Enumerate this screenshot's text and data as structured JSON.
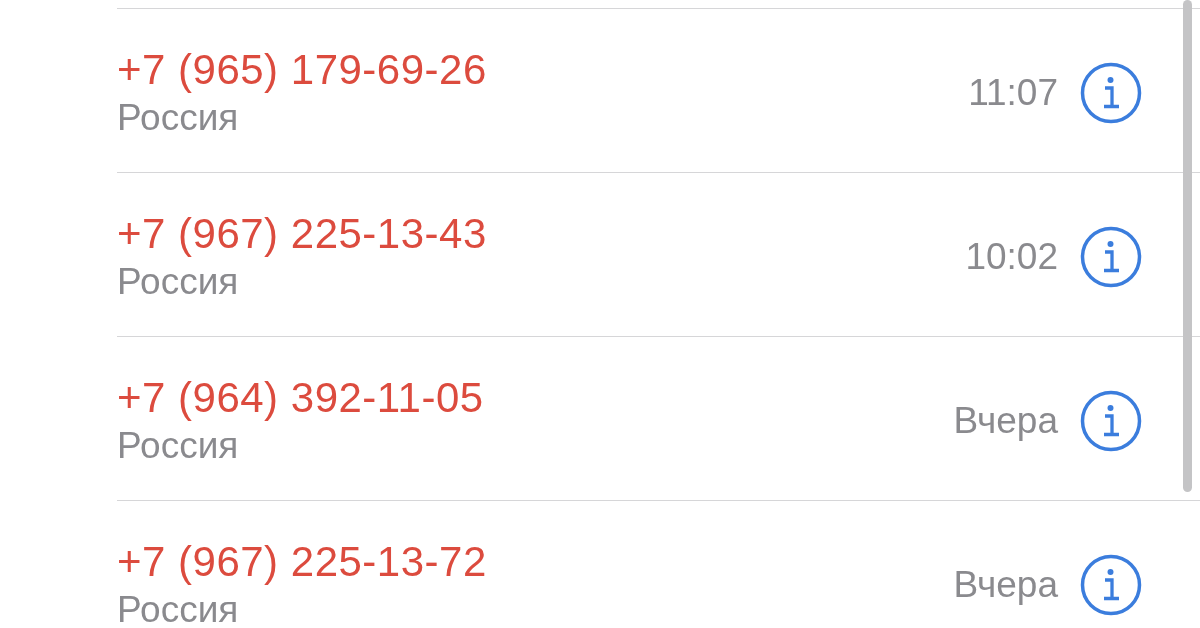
{
  "calls": [
    {
      "number": "+7 (965) 179-69-26",
      "country": "Россия",
      "time": "11:07",
      "missed": true
    },
    {
      "number": "+7 (967) 225-13-43",
      "country": "Россия",
      "time": "10:02",
      "missed": true
    },
    {
      "number": "+7 (964) 392-11-05",
      "country": "Россия",
      "time": "Вчера",
      "missed": true
    },
    {
      "number": "+7 (967) 225-13-72",
      "country": "Россия",
      "time": "Вчера",
      "missed": true
    }
  ]
}
